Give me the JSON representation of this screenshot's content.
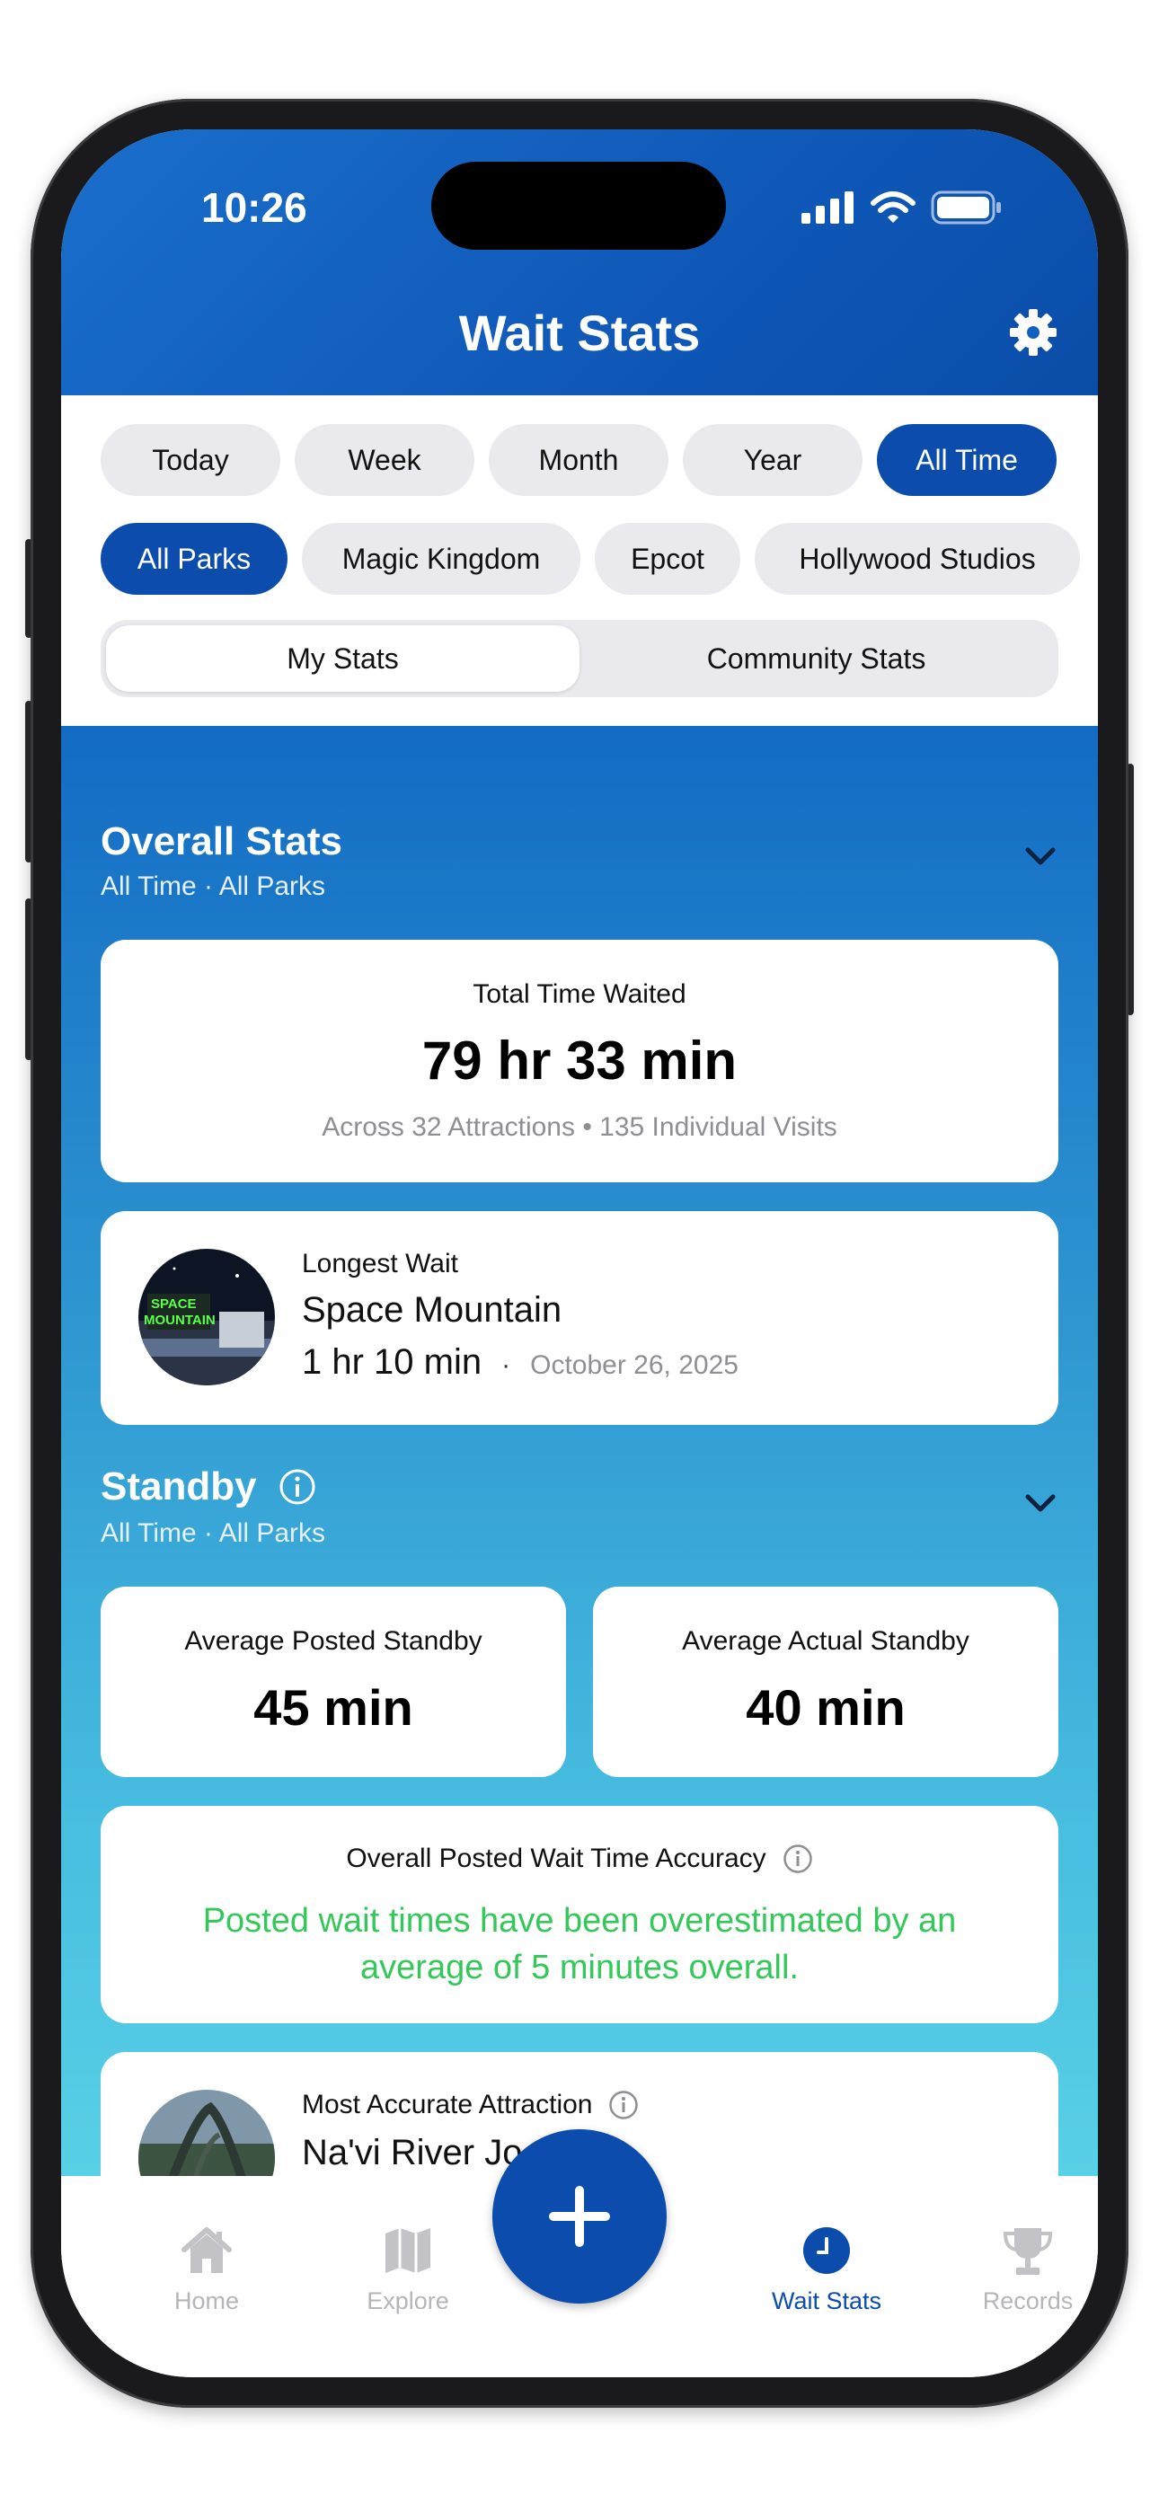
{
  "status_bar": {
    "time": "10:26"
  },
  "header": {
    "title": "Wait Stats"
  },
  "time_filters": [
    "Today",
    "Week",
    "Month",
    "Year",
    "All Time"
  ],
  "time_filter_active": "All Time",
  "park_filters": [
    "All Parks",
    "Magic Kingdom",
    "Epcot",
    "Hollywood Studios"
  ],
  "park_filter_active": "All Parks",
  "segment": {
    "left": "My Stats",
    "right": "Community Stats",
    "active": "My Stats"
  },
  "overall": {
    "title": "Overall Stats",
    "subtitle": "All Time · All Parks",
    "total_label": "Total Time Waited",
    "total_value": "79 hr 33 min",
    "total_detail": "Across 32 Attractions • 135 Individual Visits",
    "longest_label": "Longest Wait",
    "longest_attraction": "Space Mountain",
    "longest_time": "1 hr 10 min",
    "longest_separator": "·",
    "longest_date": "October 26, 2025"
  },
  "standby": {
    "title": "Standby",
    "subtitle": "All Time · All Parks",
    "posted_label": "Average Posted Standby",
    "posted_value": "45 min",
    "actual_label": "Average Actual Standby",
    "actual_value": "40 min",
    "accuracy_label": "Overall Posted Wait Time Accuracy",
    "accuracy_message": "Posted wait times have been overestimated by an average of 5 minutes overall.",
    "most_accurate_label": "Most Accurate Attraction",
    "most_accurate_attraction": "Na'vi River Jo"
  },
  "tabs": [
    "Home",
    "Explore",
    "Wait Stats",
    "Records"
  ],
  "active_tab": "Wait Stats",
  "colors": {
    "primary": "#0b4cad",
    "success": "#34c759",
    "pill_bg": "#e9e9ee"
  }
}
